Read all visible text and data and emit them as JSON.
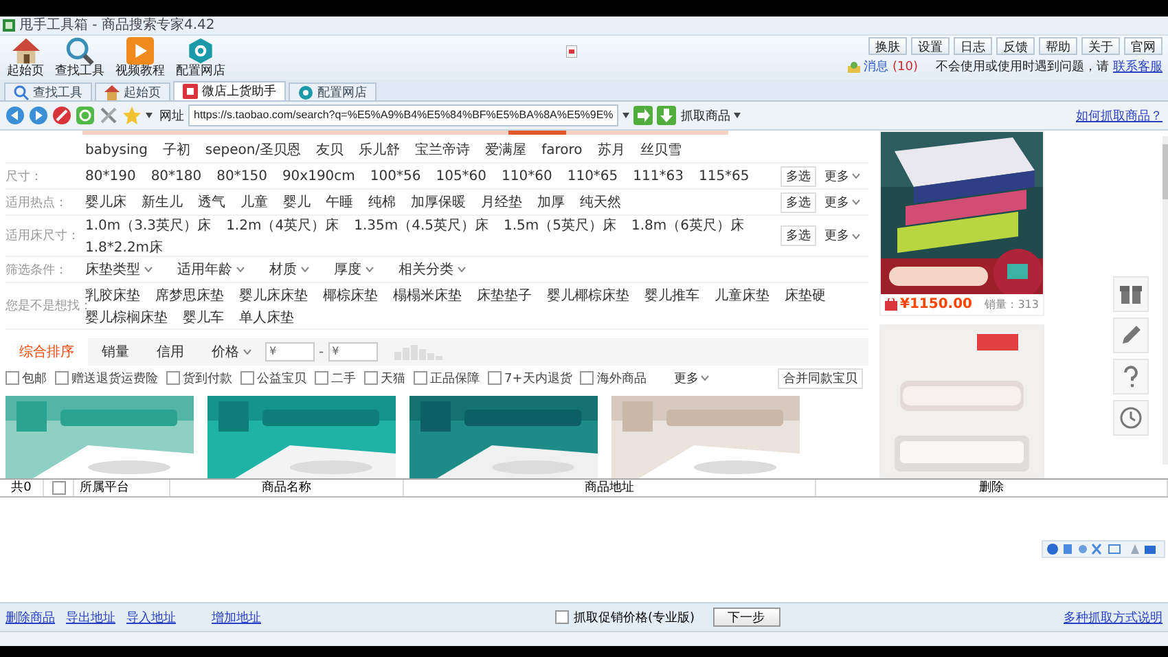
{
  "window": {
    "title": "甩手工具箱 - 商品搜索专家4.42"
  },
  "toolbar": {
    "tools": [
      "起始页",
      "查找工具",
      "视频教程",
      "配置网店"
    ],
    "buttons": [
      "换肤",
      "设置",
      "日志",
      "反馈",
      "帮助",
      "关于",
      "官网"
    ],
    "message_label": "消息",
    "message_count": "(10)",
    "help_text": "不会使用或使用时遇到问题，请",
    "help_link": "联系客服"
  },
  "tabs": [
    {
      "label": "查找工具",
      "selected": false
    },
    {
      "label": "起始页",
      "selected": false
    },
    {
      "label": "微店上货助手",
      "selected": true
    },
    {
      "label": "配置网店",
      "selected": false
    }
  ],
  "nav": {
    "address_label": "网址",
    "url": "https://s.taobao.com/search?q=%E5%A9%B4%E5%84%BF%E5%BA%8A%E5%9E%",
    "grab_button": "抓取商品",
    "help_link": "如何抓取商品？"
  },
  "page": {
    "brands": [
      "babysing",
      "子初",
      "sepeon/圣贝恩",
      "友贝",
      "乐儿舒",
      "宝兰帝诗",
      "爱满屋",
      "faroro",
      "苏月",
      "丝贝雪"
    ],
    "filters": [
      {
        "label": "尺寸：",
        "values": [
          "80*190",
          "80*180",
          "80*150",
          "90x190cm",
          "100*56",
          "105*60",
          "110*60",
          "110*65",
          "111*63",
          "115*65"
        ],
        "multi": "多选",
        "more": "更多"
      },
      {
        "label": "适用热点：",
        "values": [
          "婴儿床",
          "新生儿",
          "透气",
          "儿童",
          "婴儿",
          "午睡",
          "纯棉",
          "加厚保暖",
          "月经垫",
          "加厚",
          "纯天然"
        ],
        "multi": "多选",
        "more": "更多"
      },
      {
        "label": "适用床尺寸：",
        "values": [
          "1.0m（3.3英尺）床",
          "1.2m（4英尺）床",
          "1.35m（4.5英尺）床",
          "1.5m（5英尺）床",
          "1.8m（6英尺）床",
          "1.8*2.2m床"
        ],
        "multi": "多选",
        "more": "更多"
      }
    ],
    "conditions": {
      "label": "筛选条件：",
      "options": [
        "床垫类型",
        "适用年龄",
        "材质",
        "厚度",
        "相关分类"
      ]
    },
    "suggest": {
      "label": "您是不是想找：",
      "items": [
        "乳胶床垫",
        "席梦思床垫",
        "婴儿床床垫",
        "椰棕床垫",
        "榻榻米床垫",
        "床垫垫子",
        "婴儿椰棕床垫",
        "婴儿推车",
        "儿童床垫",
        "床垫硬",
        "婴儿棕榈床垫",
        "婴儿车",
        "单人床垫"
      ]
    },
    "sort": {
      "options": [
        {
          "label": "综合排序",
          "selected": true
        },
        {
          "label": "销量",
          "selected": false
        },
        {
          "label": "信用",
          "selected": false
        },
        {
          "label": "价格",
          "selected": false
        }
      ],
      "price_from": "¥",
      "price_separator": "-",
      "price_to": "¥"
    },
    "checks": [
      {
        "label": "包邮",
        "checked": false
      },
      {
        "label": "赠送退货运费险",
        "checked": false
      },
      {
        "label": "货到付款",
        "checked": false
      },
      {
        "label": "公益宝贝",
        "checked": false
      },
      {
        "label": "二手",
        "checked": false
      },
      {
        "label": "天猫",
        "checked": false
      },
      {
        "label": "正品保障",
        "checked": false
      },
      {
        "label": "7+天内退货",
        "checked": false
      },
      {
        "label": "海外商品",
        "checked": false
      }
    ],
    "more": "更多",
    "merge": "合并同款宝贝",
    "banners": [
      {
        "kind": "picture"
      },
      {
        "kind": "picture"
      },
      {
        "kind": "picture"
      },
      {
        "kind": "picture"
      }
    ],
    "side_item": {
      "price": "¥1150.00",
      "sales": "销量：313"
    }
  },
  "table": {
    "count": "共0",
    "all_checked": false,
    "columns": [
      "所属平台",
      "商品名称",
      "商品地址",
      "删除"
    ]
  },
  "bottom": {
    "links": [
      "删除商品",
      "导出地址",
      "导入地址",
      "增加地址"
    ],
    "promo": {
      "label": "抓取促销价格(专业版)",
      "checked": false
    },
    "next_button": "下一步",
    "help_link": "多种抓取方式说明"
  }
}
